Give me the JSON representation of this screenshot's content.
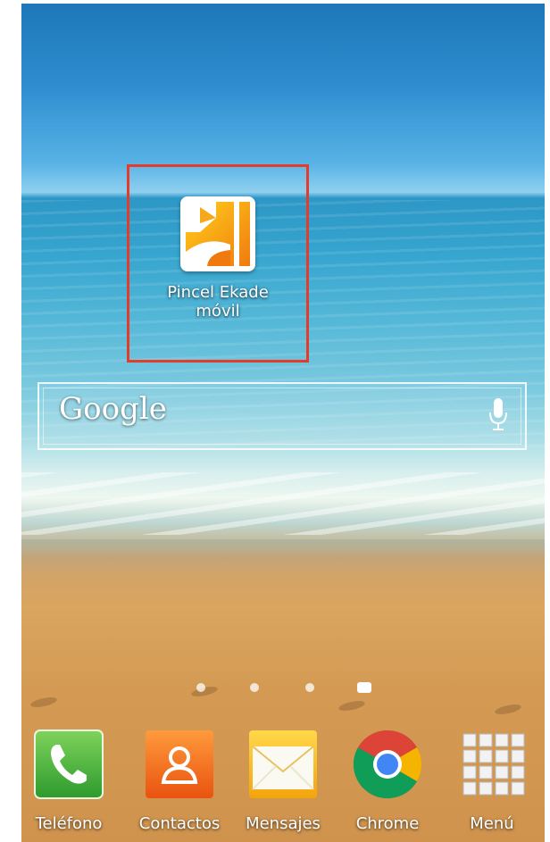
{
  "home_screen": {
    "wallpaper": "beach",
    "highlighted_app": {
      "label_line1": "Pincel Ekade",
      "label_line2": "móvil",
      "icon": "pincel-ekade-icon",
      "highlight_color": "#e53b2a"
    },
    "search_widget": {
      "logo_text": "Google",
      "mic_icon": "microphone-icon"
    },
    "page_indicator": {
      "pages": 4,
      "active_page": 4
    }
  },
  "dock": {
    "items": [
      {
        "label": "Teléfono",
        "icon": "phone-icon"
      },
      {
        "label": "Contactos",
        "icon": "contacts-icon"
      },
      {
        "label": "Mensajes",
        "icon": "messages-icon"
      },
      {
        "label": "Chrome",
        "icon": "chrome-icon"
      },
      {
        "label": "Menú",
        "icon": "apps-grid-icon"
      }
    ]
  }
}
